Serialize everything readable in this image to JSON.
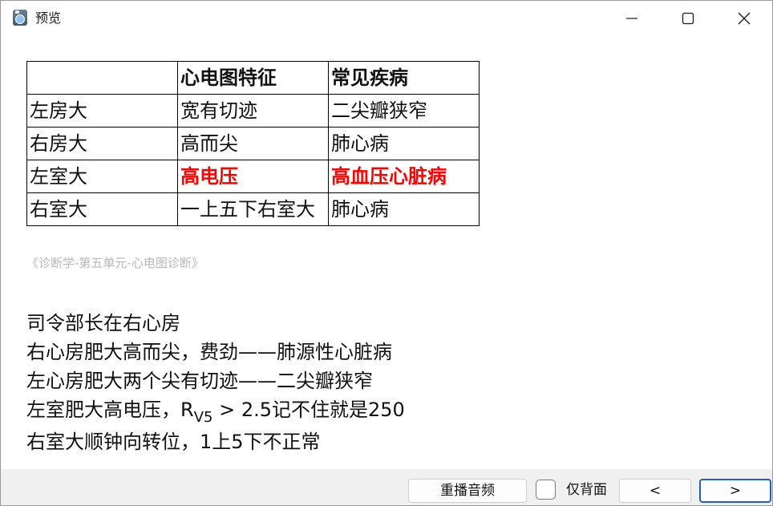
{
  "window": {
    "title": "预览",
    "app_icon": "slideshow-app-icon",
    "controls": [
      "minimize-icon",
      "maximize-icon",
      "close-icon"
    ]
  },
  "table": {
    "headers": [
      "",
      "心电图特征",
      "常见疾病"
    ],
    "rows": [
      {
        "cells": [
          "左房大",
          "宽有切迹",
          "二尖瓣狭窄"
        ],
        "highlight": false
      },
      {
        "cells": [
          "右房大",
          "高而尖",
          "肺心病"
        ],
        "highlight": false
      },
      {
        "cells": [
          "左室大",
          "高电压",
          "高血压心脏病"
        ],
        "highlight": true
      },
      {
        "cells": [
          "右室大",
          "一上五下右室大",
          "肺心病"
        ],
        "highlight": false
      }
    ],
    "highlight_color": "#ff0000"
  },
  "source": "《诊断学-第五单元-心电图诊断》",
  "notes": {
    "line1": "司令部长在右心房",
    "line2": "右心房肥大高而尖，费劲——肺源性心脏病",
    "line3": "左心房肥大两个尖有切迹——二尖瓣狭窄",
    "line4_before": "左室肥大高电压，R",
    "line4_sub": "V5",
    "line4_after": " > 2.5记不住就是250",
    "line5": "右室大顺钟向转位，1上5下不正常"
  },
  "bottom_bar": {
    "replay_label": "重播音频",
    "back_only_label": "仅背面",
    "back_only_checked": false,
    "prev_label": "<",
    "next_label": ">"
  }
}
